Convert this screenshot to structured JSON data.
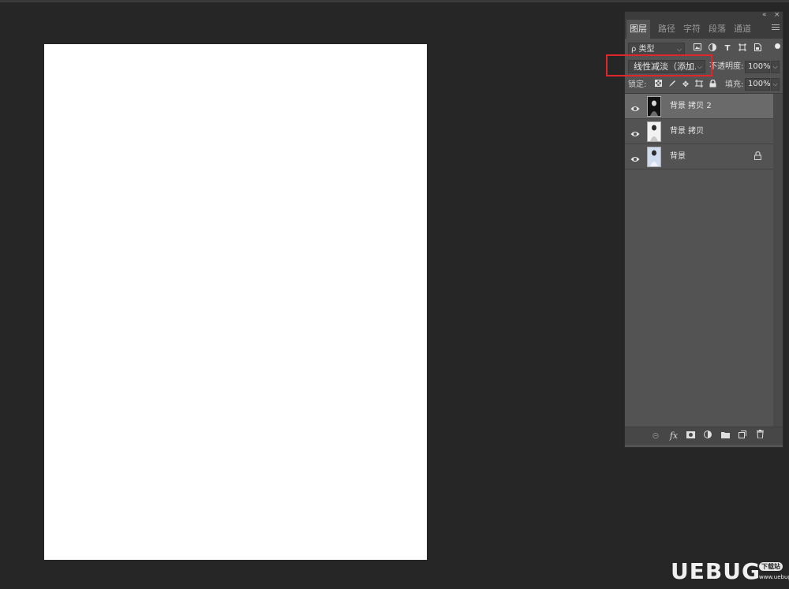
{
  "panel": {
    "collapse_glyph": "«",
    "close_glyph": "×",
    "tabs": [
      "图层",
      "路径",
      "字符",
      "段落",
      "通道"
    ],
    "active_tab": 0,
    "filter": {
      "label": "ρ 类型",
      "filter_icons": [
        "image-filter-icon",
        "adjustment-filter-icon",
        "type-filter-icon",
        "shape-filter-icon",
        "smart-object-filter-icon"
      ]
    },
    "blend_mode": "线性减淡（添加...",
    "opacity_label": "不透明度:",
    "opacity_value": "100%",
    "lock_label": "锁定:",
    "fill_label": "填充:",
    "fill_value": "100%",
    "layers": [
      {
        "name": "背景 拷贝 2",
        "selected": true,
        "locked": false,
        "thumb_colors": [
          "#111111",
          "#d8d8d8"
        ]
      },
      {
        "name": "背景 拷贝",
        "selected": false,
        "locked": false,
        "thumb_colors": [
          "#f2f2f2",
          "#2a2a2a"
        ]
      },
      {
        "name": "背景",
        "selected": false,
        "locked": true,
        "thumb_colors": [
          "#cfdcf0",
          "#2a2a2a"
        ]
      }
    ]
  },
  "watermark": {
    "text": "UEBUG",
    "badge": "下载站",
    "url": "www.uebug.com"
  },
  "colors": {
    "workspace": "#262626",
    "panel": "#535353",
    "highlight": "#e0262b",
    "selected_layer": "#6a6a6a"
  }
}
